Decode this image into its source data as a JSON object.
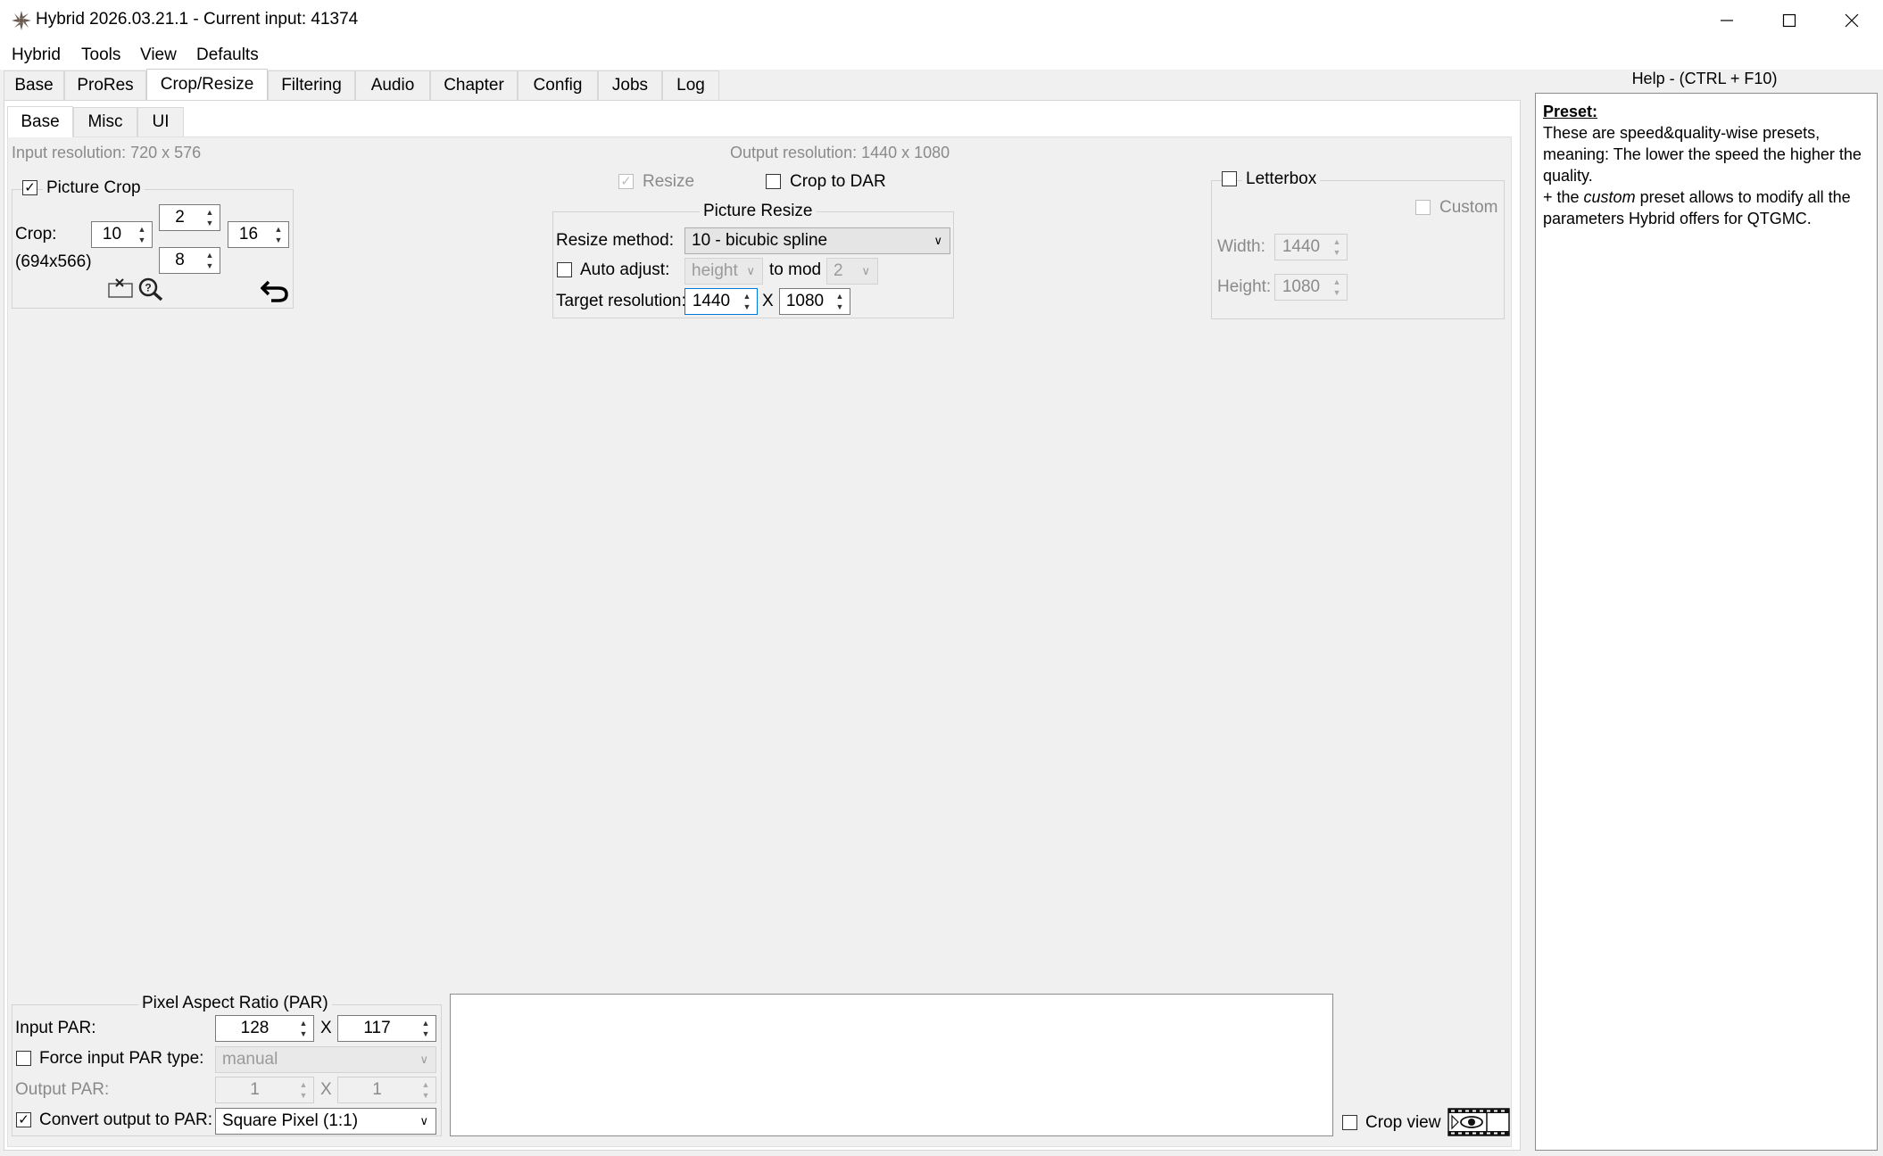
{
  "window": {
    "title": "Hybrid 2026.03.21.1 - Current input: 41374",
    "minimize": "—",
    "maximize": "☐",
    "close": "✕"
  },
  "menu": [
    "Hybrid",
    "Tools",
    "View",
    "Defaults"
  ],
  "tabs": [
    "Base",
    "ProRes",
    "Crop/Resize",
    "Filtering",
    "Audio",
    "Chapter",
    "Config",
    "Jobs",
    "Log"
  ],
  "active_tab": "Crop/Resize",
  "subtabs": [
    "Base",
    "Misc",
    "UI"
  ],
  "active_subtab": "Base",
  "input_resolution": "Input resolution: 720 x 576",
  "output_resolution": "Output resolution: 1440 x 1080",
  "picture_crop": {
    "label": "Picture Crop",
    "checked": true,
    "crop_label": "Crop:",
    "left": "10",
    "top": "2",
    "right": "16",
    "bottom": "8",
    "size": "(694x566)"
  },
  "resize": {
    "resize_label": "Resize",
    "crop_to_dar_label": "Crop to DAR",
    "group_title": "Picture Resize",
    "method_label": "Resize method:",
    "method_value": "10 - bicubic spline",
    "auto_adjust_label": "Auto adjust:",
    "auto_adjust_value": "height",
    "to_mod_label": "to mod",
    "mod_value": "2",
    "target_label": "Target resolution:",
    "target_width": "1440",
    "x_label": "X",
    "target_height": "1080"
  },
  "letterbox": {
    "label": "Letterbox",
    "custom_label": "Custom",
    "width_label": "Width:",
    "width_value": "1440",
    "height_label": "Height:",
    "height_value": "1080"
  },
  "par": {
    "group_title": "Pixel Aspect Ratio (PAR)",
    "input_label": "Input PAR:",
    "input_num": "128",
    "input_den": "117",
    "x_label": "X",
    "force_label": "Force input PAR type:",
    "force_value": "manual",
    "output_label": "Output PAR:",
    "output_num": "1",
    "output_den": "1",
    "convert_label": "Convert output to PAR:",
    "convert_value": "Square Pixel (1:1)"
  },
  "crop_view_label": "Crop view",
  "help": {
    "title": "Help - (CTRL + F10)",
    "heading": "Preset:",
    "line1": "These are speed&quality-wise presets, meaning: The lower the speed the higher the quality.",
    "line2_pre": "+ the ",
    "line2_em": "custom",
    "line2_post": " preset allows to modify all the parameters Hybrid offers for QTGMC."
  },
  "colors": {
    "accent": "#0078d7",
    "panel": "#f0f0f0",
    "disabled_text": "#8a8a8a"
  }
}
